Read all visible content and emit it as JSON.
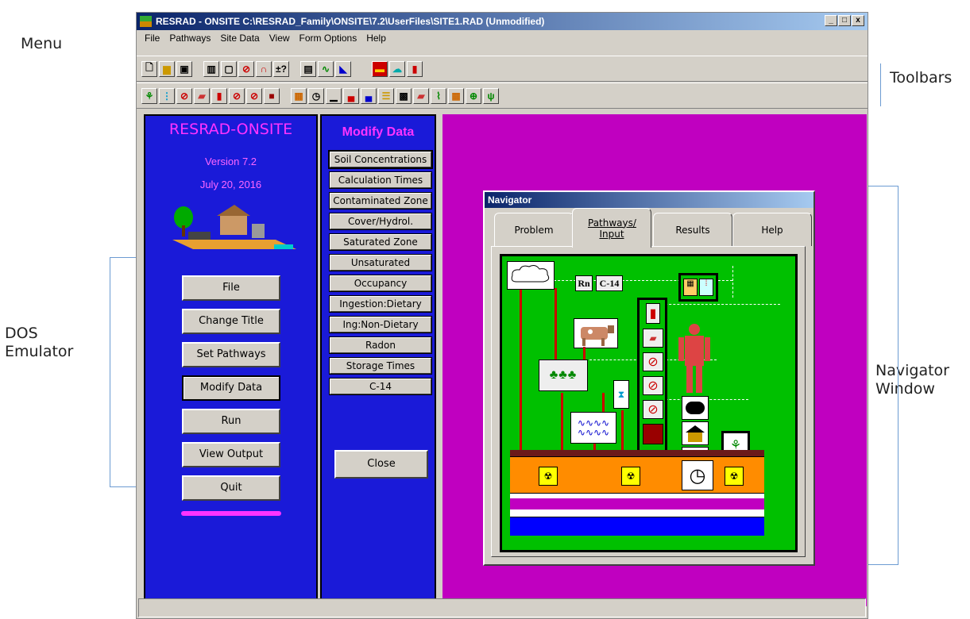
{
  "callouts": {
    "menu": "Menu",
    "toolbars": "Toolbars",
    "dos": "DOS Emulator",
    "navigator": "Navigator Window"
  },
  "window": {
    "title": "RESRAD - ONSITE C:\\RESRAD_Family\\ONSITE\\7.2\\UserFiles\\SITE1.RAD (Unmodified)",
    "buttons": [
      "_",
      "□",
      "x"
    ]
  },
  "menu": [
    "File",
    "Pathways",
    "Site Data",
    "View",
    "Form Options",
    "Help"
  ],
  "left_panel": {
    "app_name": "RESRAD-ONSITE",
    "version": "Version 7.2",
    "date": "July 20, 2016",
    "buttons": [
      "File",
      "Change Title",
      "Set Pathways",
      "Modify Data",
      "Run",
      "View Output",
      "Quit"
    ]
  },
  "modify_panel": {
    "heading": "Modify Data",
    "buttons": [
      "Soil Concentrations",
      "Calculation Times",
      "Contaminated Zone",
      "Cover/Hydrol.",
      "Saturated Zone",
      "Unsaturated",
      "Occupancy",
      "Ingestion:Dietary",
      "Ing:Non-Dietary",
      "Radon",
      "Storage Times",
      "C-14"
    ],
    "close": "Close"
  },
  "navigator": {
    "title": "Navigator",
    "tabs": [
      "Problem",
      "Pathways/ Input",
      "Results",
      "Help"
    ],
    "labels": {
      "rn": "Rn",
      "c14": "C-14"
    }
  },
  "colors": {
    "blue_panel": "#1a1ad8",
    "magenta": "#c000c0",
    "app_name": "#ff33ff",
    "version": "#ff66ff"
  }
}
